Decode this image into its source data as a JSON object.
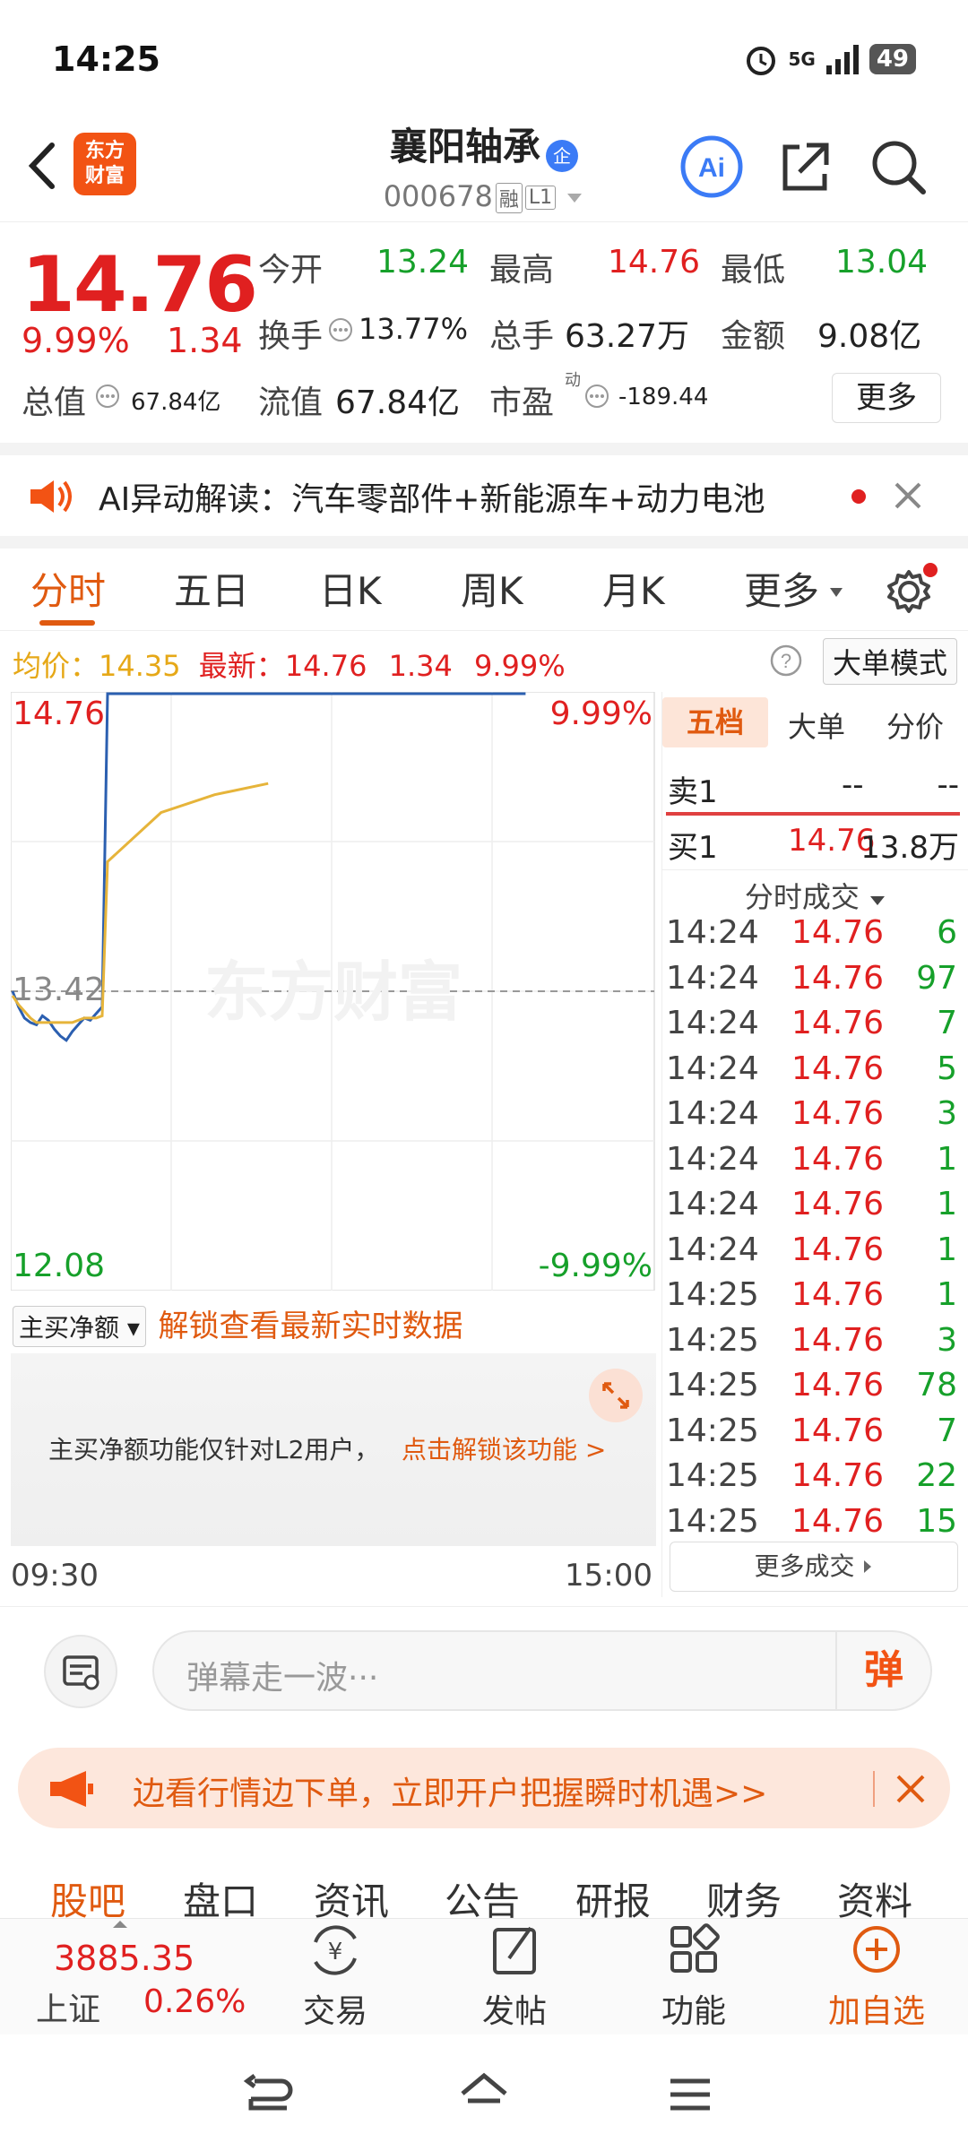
{
  "status": {
    "time": "14:25",
    "signal": "5G",
    "battery": "49"
  },
  "header": {
    "logo_line1": "东方",
    "logo_line2": "财富",
    "title": "襄阳轴承",
    "badge": "企",
    "code": "000678",
    "tag1": "融",
    "tag2": "L1",
    "ai_label": "Ai"
  },
  "quote": {
    "price": "14.76",
    "change_pct": "9.99%",
    "change": "1.34",
    "open_label": "今开",
    "open": "13.24",
    "high_label": "最高",
    "high": "14.76",
    "low_label": "最低",
    "low": "13.04",
    "turnover_label": "换手",
    "turnover": "13.77%",
    "volume_label": "总手",
    "volume": "63.27万",
    "amount_label": "金额",
    "amount": "9.08亿",
    "mktcap_label": "总值",
    "mktcap": "67.84亿",
    "float_label": "流值",
    "float": "67.84亿",
    "pe_label": "市盈",
    "pe_sup": "动",
    "pe": "-189.44",
    "more_label": "更多"
  },
  "ai_banner": {
    "text": "AI异动解读：汽车零部件+新能源车+动力电池"
  },
  "tabs": [
    {
      "label": "分时",
      "active": true
    },
    {
      "label": "五日"
    },
    {
      "label": "日K"
    },
    {
      "label": "周K"
    },
    {
      "label": "月K"
    },
    {
      "label": "更多"
    }
  ],
  "avg_bar": {
    "avg_label": "均价：",
    "avg": "14.35",
    "last_label": "最新：",
    "last": "14.76",
    "chg": "1.34",
    "pct": "9.99%",
    "big_order_label": "大单模式"
  },
  "chart_data": {
    "type": "line",
    "y_top": "14.76",
    "y_mid": "13.42",
    "y_bottom": "12.08",
    "pct_top": "9.99%",
    "pct_bottom": "-9.99%",
    "x_start": "09:30",
    "x_end": "15:00",
    "watermark": "东方财富",
    "ylim": [
      12.08,
      14.76
    ],
    "series": [
      {
        "color": "#2b5fb0",
        "values": [
          13.42,
          13.35,
          13.3,
          13.28,
          13.27,
          13.31,
          13.29,
          13.25,
          13.22,
          13.2,
          13.24,
          13.27,
          13.3,
          13.29,
          13.32,
          13.35,
          14.76,
          14.76,
          14.76,
          14.76
        ]
      },
      {
        "color": "#e6b43a",
        "values": [
          13.4,
          13.36,
          13.33,
          13.3,
          13.28,
          13.28,
          13.28,
          13.28,
          13.28,
          13.28,
          13.28,
          13.29,
          13.3,
          13.3,
          13.3,
          13.31,
          14.0,
          14.22,
          14.3,
          14.35
        ]
      }
    ]
  },
  "order_panel": {
    "tabs": [
      "五档",
      "大单",
      "分价"
    ],
    "sell1_label": "卖1",
    "sell1_price": "--",
    "sell1_vol": "--",
    "buy1_label": "买1",
    "buy1_price": "14.76",
    "buy1_vol": "13.8万",
    "trades_title": "分时成交",
    "trades": [
      {
        "t": "14:24",
        "p": "14.76",
        "v": "6"
      },
      {
        "t": "14:24",
        "p": "14.76",
        "v": "97"
      },
      {
        "t": "14:24",
        "p": "14.76",
        "v": "7"
      },
      {
        "t": "14:24",
        "p": "14.76",
        "v": "5"
      },
      {
        "t": "14:24",
        "p": "14.76",
        "v": "3"
      },
      {
        "t": "14:24",
        "p": "14.76",
        "v": "1"
      },
      {
        "t": "14:24",
        "p": "14.76",
        "v": "1"
      },
      {
        "t": "14:24",
        "p": "14.76",
        "v": "1"
      },
      {
        "t": "14:25",
        "p": "14.76",
        "v": "1"
      },
      {
        "t": "14:25",
        "p": "14.76",
        "v": "3"
      },
      {
        "t": "14:25",
        "p": "14.76",
        "v": "78"
      },
      {
        "t": "14:25",
        "p": "14.76",
        "v": "7"
      },
      {
        "t": "14:25",
        "p": "14.76",
        "v": "22"
      },
      {
        "t": "14:25",
        "p": "14.76",
        "v": "15"
      }
    ],
    "more_trades": "更多成交"
  },
  "l2": {
    "dropdown": "主买净额",
    "unlock": "解锁查看最新实时数据",
    "box_text": "主买净额功能仅针对L2用户，",
    "box_link": "点击解锁该功能 >"
  },
  "comment": {
    "placeholder": "弹幕走一波···",
    "send": "弹"
  },
  "promo": {
    "text": "边看行情边下单，立即开户把握瞬时机遇>>"
  },
  "section_tabs": [
    "股吧",
    "盘口",
    "资讯",
    "公告",
    "研报",
    "财务",
    "资料"
  ],
  "bottom_bar": {
    "index_value": "3885.35",
    "index_name": "上证",
    "index_pct": "0.26%",
    "items": [
      "交易",
      "发帖",
      "功能",
      "加自选"
    ]
  }
}
